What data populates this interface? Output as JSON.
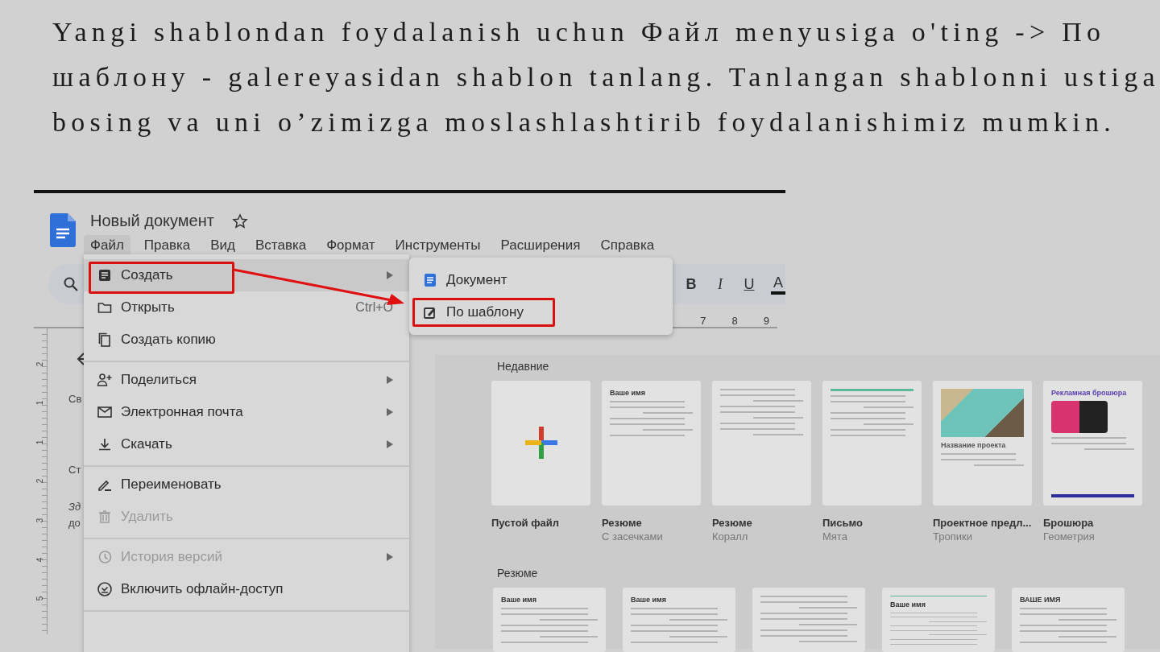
{
  "heading": "Yangi shablondan foydalanish uchun Файл menyusiga o'ting -> По шаблону - galereyasidan shablon tanlang. Tanlangan shablonni ustiga bosing va uni o’zimizga moslashlashtirib foydalanishimiz mumkin.",
  "document": {
    "title": "Новый документ"
  },
  "menu_bar": [
    {
      "label": "Файл",
      "selected": true
    },
    {
      "label": "Правка",
      "selected": false
    },
    {
      "label": "Вид",
      "selected": false
    },
    {
      "label": "Вставка",
      "selected": false
    },
    {
      "label": "Формат",
      "selected": false
    },
    {
      "label": "Инструменты",
      "selected": false
    },
    {
      "label": "Расширения",
      "selected": false
    },
    {
      "label": "Справка",
      "selected": false
    }
  ],
  "format_buttons": [
    {
      "label": "B",
      "kind": "bold"
    },
    {
      "label": "I",
      "kind": "italic"
    },
    {
      "label": "U",
      "kind": "underline"
    },
    {
      "label": "A",
      "kind": "color"
    }
  ],
  "ruler_numbers": [
    "7",
    "8",
    "9"
  ],
  "side_ruler_numbers": [
    "2",
    "1",
    "1",
    "2",
    "3",
    "4",
    "5"
  ],
  "page_fragments": [
    "Св",
    "Ст",
    "Зд",
    "до"
  ],
  "file_menu": [
    [
      {
        "label": "Создать",
        "kind": "doc",
        "submenu": true,
        "hovered": true,
        "highlighted": true,
        "disabled": false
      },
      {
        "label": "Открыть",
        "kind": "folder",
        "shortcut": "Ctrl+O",
        "submenu": false,
        "hovered": false,
        "highlighted": false,
        "disabled": false
      },
      {
        "label": "Создать копию",
        "kind": "copy",
        "submenu": false,
        "hovered": false,
        "highlighted": false,
        "disabled": false
      }
    ],
    [
      {
        "label": "Поделиться",
        "kind": "share",
        "submenu": true,
        "hovered": false,
        "highlighted": false,
        "disabled": false
      },
      {
        "label": "Электронная почта",
        "kind": "mail",
        "submenu": true,
        "hovered": false,
        "highlighted": false,
        "disabled": false
      },
      {
        "label": "Скачать",
        "kind": "download",
        "submenu": true,
        "hovered": false,
        "highlighted": false,
        "disabled": false
      }
    ],
    [
      {
        "label": "Переименовать",
        "kind": "rename",
        "submenu": false,
        "hovered": false,
        "highlighted": false,
        "disabled": false
      },
      {
        "label": "Удалить",
        "kind": "trash",
        "submenu": false,
        "hovered": false,
        "highlighted": false,
        "disabled": true
      }
    ],
    [
      {
        "label": "История версий",
        "kind": "history",
        "submenu": true,
        "hovered": false,
        "highlighted": false,
        "disabled": true
      },
      {
        "label": "Включить офлайн-доступ",
        "kind": "offline",
        "submenu": false,
        "hovered": false,
        "highlighted": false,
        "disabled": false
      }
    ]
  ],
  "create_submenu": [
    {
      "label": "Документ",
      "kind": "doc",
      "highlighted": false
    },
    {
      "label": "По шаблону",
      "kind": "template",
      "highlighted": true
    }
  ],
  "template_gallery": [
    {
      "title": "Недавние",
      "templates": [
        {
          "kind": "blank",
          "title": "Пустой файл"
        },
        {
          "kind": "resume",
          "title": "Резюме",
          "subtitle": "С засечками",
          "preview_heading": "Ваше имя"
        },
        {
          "kind": "text",
          "title": "Резюме",
          "subtitle": "Коралл"
        },
        {
          "kind": "letter",
          "title": "Письмо",
          "subtitle": "Мята"
        },
        {
          "kind": "project",
          "title": "Проектное предл...",
          "subtitle": "Тропики",
          "preview_heading": "Название проекта"
        },
        {
          "kind": "brochure",
          "title": "Брошюра",
          "subtitle": "Геометрия",
          "preview_heading": "Рекламная брошюра"
        }
      ]
    },
    {
      "title": "Резюме",
      "templates": [
        {
          "kind": "resume",
          "preview_heading": "Ваше имя"
        },
        {
          "kind": "resume",
          "preview_heading": "Ваше имя"
        },
        {
          "kind": "text"
        },
        {
          "kind": "letter",
          "preview_heading": "Ваше имя"
        },
        {
          "kind": "resume",
          "preview_heading": "ВАШЕ ИМЯ"
        }
      ]
    }
  ]
}
